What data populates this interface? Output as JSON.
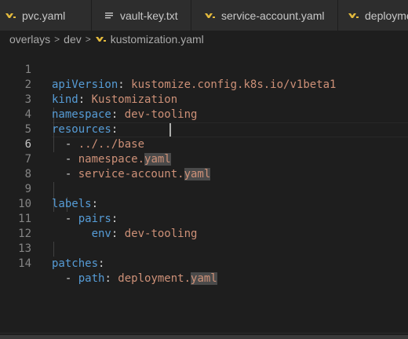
{
  "tabs": [
    {
      "label": "pvc.yaml",
      "icon": "yaml-icon"
    },
    {
      "label": "vault-key.txt",
      "icon": "text-file-icon"
    },
    {
      "label": "service-account.yaml",
      "icon": "yaml-icon"
    },
    {
      "label": "deployme",
      "icon": "yaml-icon"
    }
  ],
  "breadcrumb": {
    "folder1": "overlays",
    "sep": ">",
    "folder2": "dev",
    "file": "kustomization.yaml"
  },
  "editor": {
    "active_line": 6,
    "lines": [
      {
        "n": "1",
        "key": "apiVersion",
        "colon": ":",
        "val": "kustomize.config.k8s.io/v1beta1"
      },
      {
        "n": "2",
        "key": "kind",
        "colon": ":",
        "val": "Kustomization"
      },
      {
        "n": "3",
        "key": "namespace",
        "colon": ":",
        "val": "dev-tooling"
      },
      {
        "n": "4",
        "key": "resources",
        "colon": ":"
      },
      {
        "n": "5",
        "dash": "- ",
        "val": "../../base"
      },
      {
        "n": "6",
        "dash": "- ",
        "val": "namespace.",
        "ext": "yaml"
      },
      {
        "n": "7",
        "dash": "- ",
        "val": "service-account.",
        "ext": "yaml"
      },
      {
        "n": "8"
      },
      {
        "n": "9",
        "key": "labels",
        "colon": ":"
      },
      {
        "n": "10",
        "dash": "- ",
        "key": "pairs",
        "colon": ":"
      },
      {
        "n": "11",
        "key": "env",
        "colon": ": ",
        "val": "dev-tooling"
      },
      {
        "n": "12"
      },
      {
        "n": "13",
        "key": "patches",
        "colon": ":"
      },
      {
        "n": "14",
        "dash": "- ",
        "key": "path",
        "colon": ": ",
        "val": "deployment.",
        "ext": "yaml"
      }
    ]
  },
  "colors": {
    "background": "#1e1e1e",
    "key": "#569cd6",
    "string": "#ce9178",
    "line_number": "#858585",
    "yaml_icon": "#e2b93d"
  }
}
